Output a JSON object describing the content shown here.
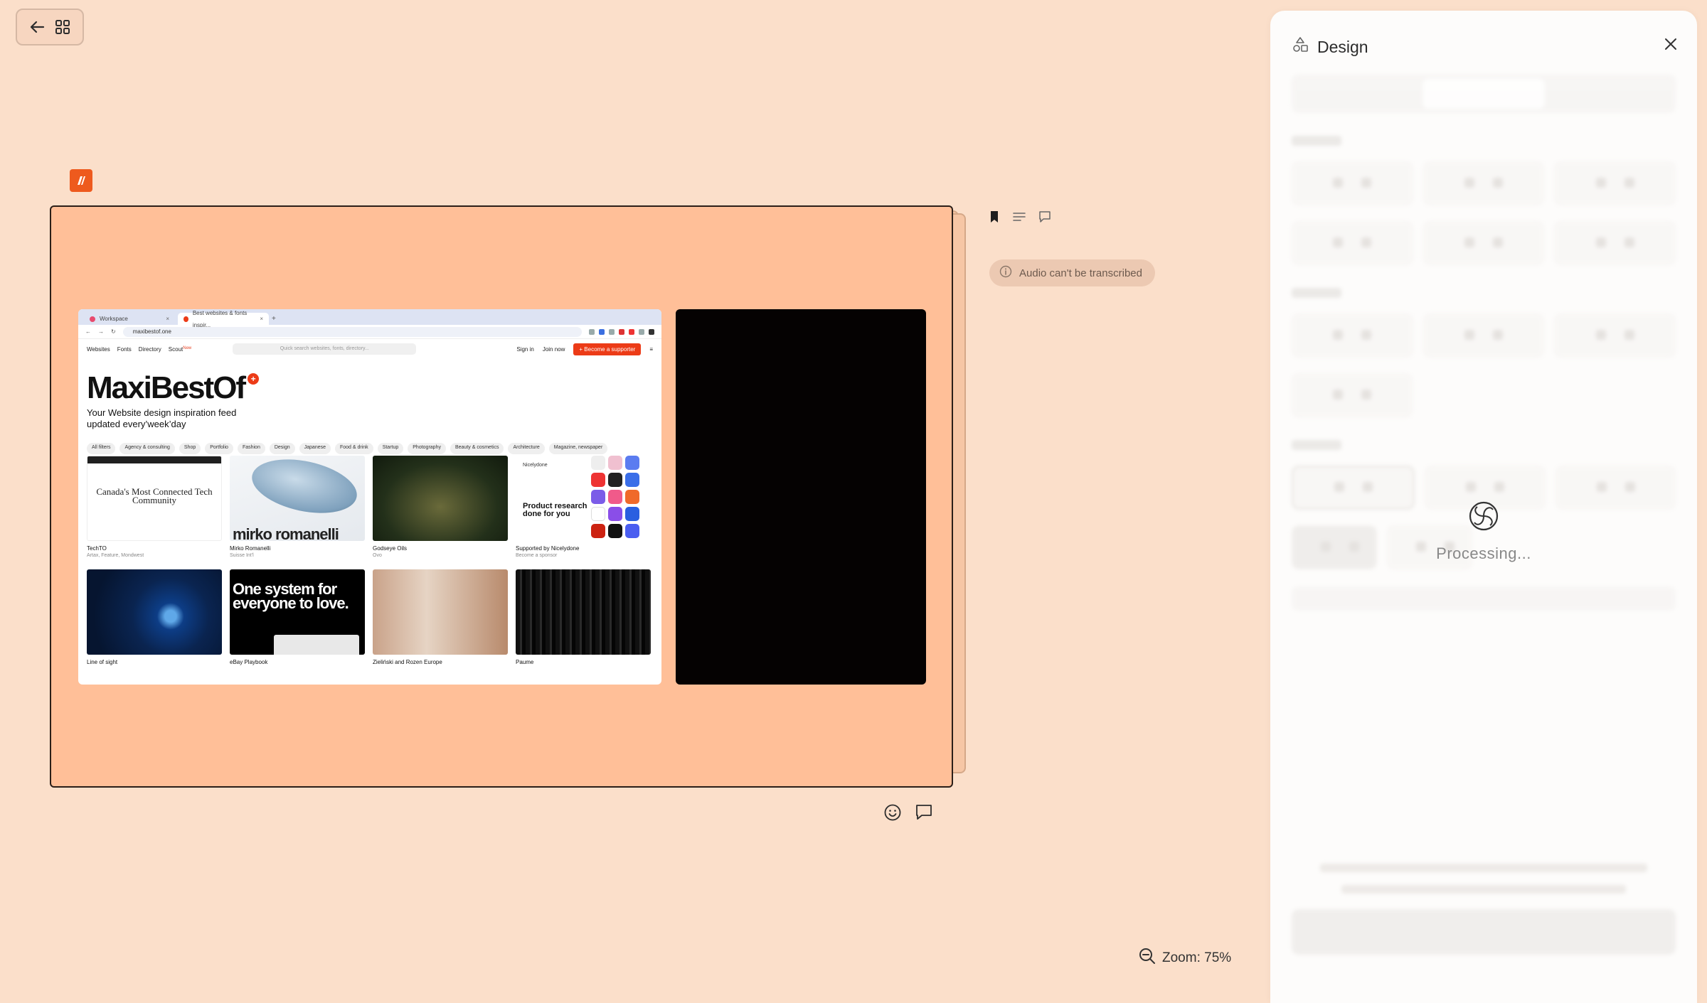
{
  "nav": {
    "back_label": "Back",
    "grid_label": "Grid view"
  },
  "slide": {
    "browser": {
      "tabs": [
        {
          "label": "Workspace"
        },
        {
          "label": "Best websites & fonts inspir..."
        }
      ],
      "url": "maxibestof.one",
      "site_nav": {
        "links": [
          "Websites",
          "Fonts",
          "Directory",
          "Scout"
        ],
        "new_badge": "New",
        "search_placeholder": "Quick search websites, fonts, directory...",
        "sign_in": "Sign in",
        "join_now": "Join now",
        "supporter": "+ Become a supporter"
      },
      "hero": {
        "title": "MaxiBestOf",
        "subtitle": "Your Website design inspiration feed updated every’week’day"
      },
      "filters": [
        "All filters",
        "Agency & consulting",
        "Shop",
        "Portfolio",
        "Fashion",
        "Design",
        "Japanese",
        "Food & drink",
        "Startup",
        "Photography",
        "Beauty & cosmetics",
        "Architecture",
        "Magazine, newspaper"
      ],
      "cards": [
        {
          "title": "TechTO",
          "sub": "Artax, Feature, Mondwest",
          "img_text": "Canada's Most Connected Tech Community"
        },
        {
          "title": "Mirko Romanelli",
          "sub": "Suisse Int'l",
          "img_text": "mirko romanelli"
        },
        {
          "title": "Godseye Oils",
          "sub": "Ovo"
        },
        {
          "title": "Supported by Nicelydone",
          "sub": "Become a sponsor",
          "img_head": "Nicelydone",
          "img_text": "Product research done for you"
        },
        {
          "title": "Line of sight",
          "sub": ""
        },
        {
          "title": "eBay Playbook",
          "sub": "",
          "img_text": "One system for everyone to love."
        },
        {
          "title": "Zieliński and Rozen Europe",
          "sub": ""
        },
        {
          "title": "Paume",
          "sub": ""
        }
      ]
    }
  },
  "audio_status": "Audio can't be transcribed",
  "zoom_label": "Zoom: 75%",
  "panel": {
    "title": "Design",
    "processing_label": "Processing..."
  },
  "colors": {
    "background": "#fbdfca",
    "slide": "#ffbf98",
    "accent": "#ee5a1e"
  }
}
